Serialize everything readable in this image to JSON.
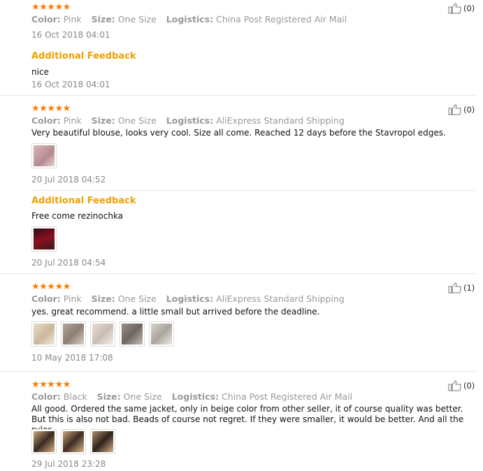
{
  "labels": {
    "color": "Color:",
    "size": "Size:",
    "logistics": "Logistics:",
    "additional_feedback": "Additional Feedback",
    "stars": "★★★★★"
  },
  "reviews": [
    {
      "color": "Pink",
      "size": "One Size",
      "logistics": "China Post Registered Air Mail",
      "helpful": "(0)",
      "date": "16 Oct 2018 04:01",
      "additional": {
        "text": "nice",
        "date": "16 Oct 2018 04:01"
      }
    },
    {
      "color": "Pink",
      "size": "One Size",
      "logistics": "AliExpress Standard Shipping",
      "helpful": "(0)",
      "text": "Very beautiful blouse, looks very cool. Size all come. Reached 12 days before the Stavropol edges.",
      "date": "20 Jul 2018 04:52",
      "additional": {
        "text": "Free come rezinochka",
        "date": "20 Jul 2018 04:54"
      }
    },
    {
      "color": "Pink",
      "size": "One Size",
      "logistics": "AliExpress Standard Shipping",
      "helpful": "(1)",
      "text": "yes. great recommend. a little small but arrived before the deadline.",
      "date": "10 May 2018 17:08"
    },
    {
      "color": "Black",
      "size": "One Size",
      "logistics": "China Post Registered Air Mail",
      "helpful": "(0)",
      "text": "All good. Ordered the same jacket, only in beige color from other seller, it of course quality was better. But this is also not bad. Beads of course not regret. If they were smaller, it would be better. And all the rules.",
      "date": "29 Jul 2018 23:28"
    }
  ],
  "colors": {
    "star": "#ff7a00",
    "additional_feedback": "#f0a000",
    "meta": "#999999",
    "divider": "#e6e6e6"
  },
  "icons": {
    "helpful": "thumbs-up-icon"
  }
}
